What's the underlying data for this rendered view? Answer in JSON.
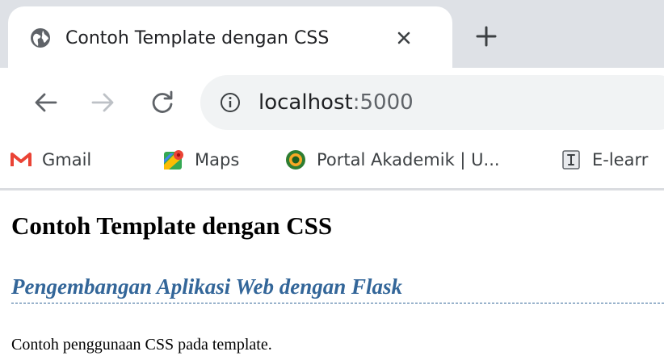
{
  "browser": {
    "tab": {
      "title": "Contoh Template dengan CSS",
      "favicon_icon": "globe-icon",
      "close_icon": "close-icon"
    },
    "new_tab_icon": "plus-icon",
    "toolbar": {
      "back_icon": "arrow-left-icon",
      "forward_icon": "arrow-right-icon",
      "reload_icon": "reload-icon",
      "info_icon": "info-icon",
      "url_host": "localhost",
      "url_port": ":5000"
    },
    "bookmarks": [
      {
        "label": "Gmail",
        "icon": "gmail-icon"
      },
      {
        "label": "Maps",
        "icon": "maps-icon"
      },
      {
        "label": "Portal Akademik | U...",
        "icon": "portal-icon"
      },
      {
        "label": "E-learr",
        "icon": "elearning-icon"
      }
    ]
  },
  "page": {
    "heading": "Contoh Template dengan CSS",
    "subheading": "Pengembangan Aplikasi Web dengan Flask",
    "paragraph": "Contoh penggunaan CSS pada template."
  },
  "colors": {
    "tabstrip_bg": "#dee1e6",
    "omnibox_bg": "#f1f3f4",
    "subheading": "#336699",
    "text": "#202124"
  }
}
